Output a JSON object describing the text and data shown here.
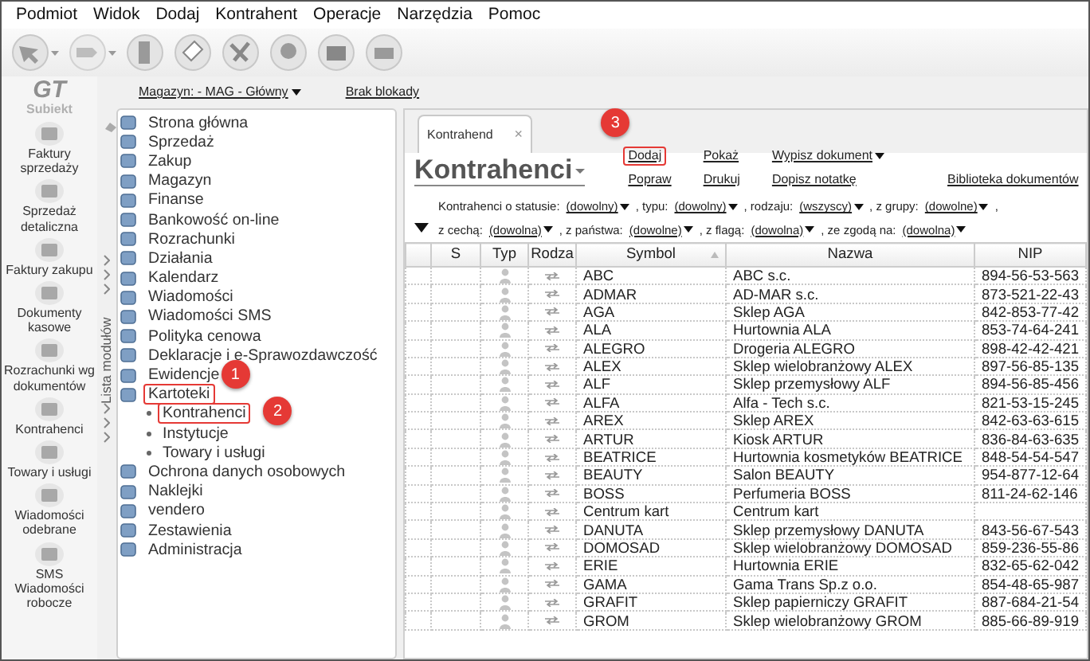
{
  "menu": [
    "Podmiot",
    "Widok",
    "Dodaj",
    "Kontrahent",
    "Operacje",
    "Narzędzia",
    "Pomoc"
  ],
  "logo": {
    "mark": "GT",
    "name": "Subiekt"
  },
  "modules": [
    {
      "label": "Faktury sprzedaży"
    },
    {
      "label": "Sprzedaż detaliczna"
    },
    {
      "label": "Faktury zakupu"
    },
    {
      "label": "Dokumenty kasowe"
    },
    {
      "label": "Rozrachunki wg dokumentów"
    },
    {
      "label": "Kontrahenci"
    },
    {
      "label": "Towary i usługi"
    },
    {
      "label": "Wiadomości odebrane"
    },
    {
      "label": "SMS Wiadomości robocze"
    }
  ],
  "modules_strip": {
    "label": "Lista modułów"
  },
  "context": {
    "warehouse": "Magazyn: - MAG - Główny",
    "lock": "Brak blokady"
  },
  "tree": [
    {
      "label": "Strona główna",
      "highlighted": false
    },
    {
      "label": "Sprzedaż",
      "highlighted": false
    },
    {
      "label": "Zakup",
      "highlighted": false
    },
    {
      "label": "Magazyn",
      "highlighted": false
    },
    {
      "label": "Finanse",
      "highlighted": false
    },
    {
      "label": "Bankowość on-line",
      "highlighted": false
    },
    {
      "label": "Rozrachunki",
      "highlighted": false
    },
    {
      "label": "Działania",
      "highlighted": false
    },
    {
      "label": "Kalendarz",
      "highlighted": false
    },
    {
      "label": "Wiadomości",
      "highlighted": false
    },
    {
      "label": "Wiadomości SMS",
      "highlighted": false
    },
    {
      "label": "Polityka cenowa",
      "highlighted": false
    },
    {
      "label": "Deklaracje i e-Sprawozdawczość",
      "highlighted": false
    },
    {
      "label": "Ewidencje",
      "highlighted": false
    },
    {
      "label": "Kartoteki",
      "highlighted": true,
      "callout": "1",
      "children": [
        {
          "label": "Kontrahenci",
          "highlighted": true,
          "callout": "2"
        },
        {
          "label": "Instytucje",
          "highlighted": false
        },
        {
          "label": "Towary i usługi",
          "highlighted": false
        }
      ]
    },
    {
      "label": "Ochrona danych osobowych",
      "highlighted": false
    },
    {
      "label": "Naklejki",
      "highlighted": false
    },
    {
      "label": "vendero",
      "highlighted": false
    },
    {
      "label": "Zestawienia",
      "highlighted": false
    },
    {
      "label": "Administracja",
      "highlighted": false
    }
  ],
  "tab": {
    "label": "Kontrahend",
    "close": "×",
    "selected": true
  },
  "title": "Kontrahenci",
  "action_columns": [
    [
      {
        "label": "Dodaj",
        "kind": "link",
        "highlighted": true,
        "callout": "3"
      },
      {
        "label": "Popraw",
        "kind": "link",
        "highlighted": false
      }
    ],
    [
      {
        "label": "Pokaż",
        "kind": "link",
        "highlighted": false
      },
      {
        "label": "Drukuj",
        "kind": "link",
        "highlighted": false
      }
    ],
    [
      {
        "label": "Wypisz dokument",
        "kind": "menu",
        "highlighted": false
      },
      {
        "label": "Dopisz notatkę",
        "kind": "link",
        "highlighted": false
      }
    ],
    [
      {
        "label": "Biblioteka dokumentów",
        "kind": "link",
        "highlighted": false
      }
    ]
  ],
  "filters": [
    [
      {
        "label": "Kontrahenci o statusie:",
        "value": "(dowolny)"
      },
      {
        "label": ", typu:",
        "value": "(dowolny)"
      },
      {
        "label": ", rodzaju:",
        "value": "(wszyscy)"
      },
      {
        "label": ", z grupy:",
        "value": "(dowolne)"
      },
      {
        "label": ","
      }
    ],
    [
      {
        "label": "z cechą:",
        "value": "(dowolna)"
      },
      {
        "label": ", z państwa:",
        "value": "(dowolne)"
      },
      {
        "label": ", z flagą:",
        "value": "(dowolna)"
      },
      {
        "label": ", ze zgodą na:",
        "value": "(dowolna)"
      }
    ]
  ],
  "table": {
    "columns": [
      {
        "label": "S",
        "sorted": false
      },
      {
        "label": "Typ",
        "sorted": false
      },
      {
        "label": "Rodza",
        "sorted": false
      },
      {
        "label": "Symbol",
        "sorted": true
      },
      {
        "label": "Nazwa",
        "sorted": false
      },
      {
        "label": "NIP",
        "sorted": false
      }
    ],
    "rows": [
      {
        "symbol": "ABC",
        "name": "ABC s.c.",
        "nip": "894-56-53-563"
      },
      {
        "symbol": "ADMAR",
        "name": "AD-MAR s.c.",
        "nip": "873-521-22-43"
      },
      {
        "symbol": "AGA",
        "name": "Sklep AGA",
        "nip": "842-853-77-42"
      },
      {
        "symbol": "ALA",
        "name": "Hurtownia ALA",
        "nip": "853-74-64-241"
      },
      {
        "symbol": "ALEGRO",
        "name": "Drogeria ALEGRO",
        "nip": "898-42-42-421"
      },
      {
        "symbol": "ALEX",
        "name": "Sklep wielobranżowy  ALEX",
        "nip": "897-56-85-135"
      },
      {
        "symbol": "ALF",
        "name": "Sklep przemysłowy ALF",
        "nip": "894-56-85-456"
      },
      {
        "symbol": "ALFA",
        "name": "Alfa - Tech s.c.",
        "nip": "821-53-15-245"
      },
      {
        "symbol": "AREX",
        "name": "Sklep AREX",
        "nip": "842-63-63-615"
      },
      {
        "symbol": "ARTUR",
        "name": "Kiosk ARTUR",
        "nip": "836-84-63-635"
      },
      {
        "symbol": "BEATRICE",
        "name": "Hurtownia kosmetyków BEATRICE",
        "nip": "848-54-54-547"
      },
      {
        "symbol": "BEAUTY",
        "name": "Salon BEAUTY",
        "nip": "954-877-12-64"
      },
      {
        "symbol": "BOSS",
        "name": "Perfumeria BOSS",
        "nip": "811-24-62-146"
      },
      {
        "symbol": "Centrum kart",
        "name": "Centrum kart"
      },
      {
        "symbol": "DANUTA",
        "name": "Sklep przemysłowy DANUTA",
        "nip": "843-56-67-543"
      },
      {
        "symbol": "DOMOSAD",
        "name": "Sklep wielobranżowy DOMOSAD",
        "nip": "859-236-55-86"
      },
      {
        "symbol": "ERIE",
        "name": "Hurtownia ERIE",
        "nip": "832-65-62-042"
      },
      {
        "symbol": "GAMA",
        "name": "Gama Trans Sp.z o.o.",
        "nip": "854-48-65-987"
      },
      {
        "symbol": "GRAFIT",
        "name": "Sklep papierniczy GRAFIT",
        "nip": "887-684-21-54"
      },
      {
        "symbol": "GROM",
        "name": "Sklep wielobranżowy GROM",
        "nip": "885-66-89-919"
      }
    ]
  }
}
